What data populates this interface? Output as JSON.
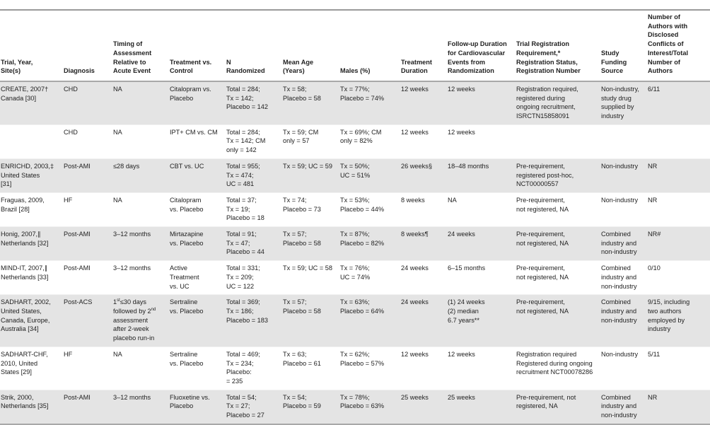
{
  "table": {
    "headers": [
      "Trial, Year,\nSite(s)",
      "Diagnosis",
      "Timing of\nAssessment\nRelative to\nAcute Event",
      "Treatment vs.\nControl",
      "N\nRandomized",
      "Mean Age\n(Years)",
      "Males (%)",
      "Treatment\nDuration",
      "Follow-up Duration\nfor Cardiovascular\nEvents from\nRandomization",
      "Trial Registration\nRequirement,*\nRegistration Status,\nRegistration Number",
      "Study\nFunding\nSource",
      "Number of\nAuthors with\nDisclosed\nConflicts of\nInterest/Total\nNumber of\nAuthors"
    ],
    "rows": [
      {
        "shaded": true,
        "cells": [
          "CREATE, 2007†\nCanada [30]",
          "CHD",
          "NA",
          "Citalopram vs.\nPlacebo",
          "Total = 284;\nTx = 142;\nPlacebo = 142",
          "Tx = 58;\nPlacebo = 58",
          "Tx = 77%;\nPlacebo = 74%",
          "12 weeks",
          "12 weeks",
          "Registration required,\nregistered during\nongoing recruitment,\nISRCTN15858091",
          "Non-industry,\nstudy drug\nsupplied by\nindustry",
          "6/11"
        ]
      },
      {
        "shaded": false,
        "cells": [
          "",
          "CHD",
          "NA",
          "IPT+ CM vs. CM",
          "Total = 284;\nTx = 142; CM\nonly = 142",
          "Tx = 59; CM\nonly = 57",
          "Tx = 69%; CM\nonly = 82%",
          "12 weeks",
          "12 weeks",
          "",
          "",
          ""
        ]
      },
      {
        "shaded": true,
        "cells": [
          "ENRICHD, 2003,‡\nUnited States\n[31]",
          "Post-AMI",
          "≤28 days",
          "CBT vs. UC",
          "Total = 955;\nTx = 474;\nUC = 481",
          "Tx = 59; UC = 59",
          "Tx = 50%;\nUC = 51%",
          "26 weeks§",
          "18–48 months",
          "Pre-requirement,\nregistered post-hoc,\nNCT00000557",
          "Non-industry",
          "NR"
        ]
      },
      {
        "shaded": false,
        "cells": [
          "Fraguas, 2009,\nBrazil [28]",
          "HF",
          "NA",
          "Citalopram\nvs. Placebo",
          "Total = 37;\nTx = 19;\nPlacebo = 18",
          "Tx = 74;\nPlacebo = 73",
          "Tx = 53%;\nPlacebo = 44%",
          "8 weeks",
          "NA",
          "Pre-requirement,\nnot registered, NA",
          "Non-industry",
          "NR"
        ]
      },
      {
        "shaded": true,
        "cells": [
          "Honig, 2007,∥\nNetherlands [32]",
          "Post-AMI",
          "3–12 months",
          "Mirtazapine\nvs. Placebo",
          "Total = 91;\nTx = 47;\nPlacebo = 44",
          "Tx = 57;\nPlacebo = 58",
          "Tx = 87%;\nPlacebo = 82%",
          "8 weeks¶",
          "24 weeks",
          "Pre-requirement,\nnot registered, NA",
          "Combined\nindustry and\nnon-industry",
          "NR#"
        ]
      },
      {
        "shaded": false,
        "cells": [
          "MIND-IT, 2007,∥\nNetherlands [33]",
          "Post-AMI",
          "3–12 months",
          "Active\nTreatment\nvs. UC",
          "Total = 331;\nTx = 209;\nUC = 122",
          "Tx = 59; UC = 58",
          "Tx = 76%;\nUC = 74%",
          "24 weeks",
          "6–15 months",
          "Pre-requirement,\nnot registered, NA",
          "Combined\nindustry and\nnon-industry",
          "0/10"
        ]
      },
      {
        "shaded": true,
        "cells": [
          "SADHART, 2002,\nUnited States,\nCanada, Europe,\nAustralia [34]",
          "Post-ACS",
          "1st≤30 days\nfollowed by 2nd\nassessment\nafter 2-week\nplacebo run-in",
          "Sertraline\nvs. Placebo",
          "Total = 369;\nTx = 186;\nPlacebo = 183",
          "Tx = 57;\nPlacebo = 58",
          "Tx = 63%;\nPlacebo = 64%",
          "24 weeks",
          "(1) 24 weeks\n(2) median\n6.7 years**",
          "Pre-requirement,\nnot registered, NA",
          "Combined\nindustry and\nnon-industry",
          "9/15, including\ntwo authors\nemployed by\nindustry"
        ]
      },
      {
        "shaded": false,
        "cells": [
          "SADHART-CHF,\n2010, United\nStates [29]",
          "HF",
          "NA",
          "Sertraline\nvs. Placebo",
          "Total = 469;\nTx = 234;\nPlacebo:\n= 235",
          "Tx = 63;\nPlacebo = 61",
          "Tx = 62%;\nPlacebo = 57%",
          "12 weeks",
          "12 weeks",
          "Registration required\nRegistered during ongoing\nrecruitment NCT00078286",
          "Non-industry",
          "5/11"
        ]
      },
      {
        "shaded": true,
        "cells": [
          "Strik, 2000,\nNetherlands [35]",
          "Post-AMI",
          "3–12 months",
          "Fluoxetine vs.\nPlacebo",
          "Total = 54;\nTx = 27;\nPlacebo = 27",
          "Tx = 54;\nPlacebo = 59",
          "Tx = 78%;\nPlacebo = 63%",
          "25 weeks",
          "25 weeks",
          "Pre-requirement, not\nregistered, NA",
          "Combined\nindustry and\nnon-industry",
          "NR"
        ]
      }
    ]
  },
  "colors": {
    "shaded_row": "#e4e4e4",
    "rule": "#a8a8a8",
    "text": "#222222"
  }
}
